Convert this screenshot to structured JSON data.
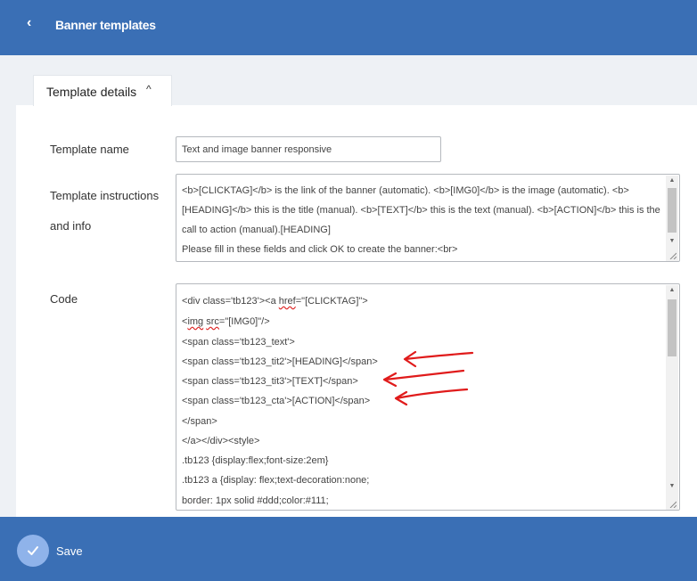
{
  "header": {
    "back_glyph": "‹",
    "title": "Banner templates"
  },
  "tab": {
    "label": "Template details",
    "chevron": "^"
  },
  "form": {
    "name_label": "Template name",
    "name_value": "Text and image banner responsive",
    "instructions_label_1": "Template instructions",
    "instructions_label_2": "and info",
    "instructions_text": "<b>[CLICKTAG]</b> is the link of the banner (automatic). <b>[IMG0]</b> is the image (automatic). <b>[HEADING]</b> this is the title (manual). <b>[TEXT]</b> this is the text (manual). <b>[ACTION]</b> this is the call to action (manual).[HEADING]",
    "instructions_text_2": "Please fill in these fields and click OK to create the banner:<br>",
    "code_label": "Code",
    "code_lines": {
      "l1_a": "<div class='tb123'><a ",
      "l1_b": "href",
      "l1_c": "=\"[CLICKTAG]\">",
      "l2_a": "<",
      "l2_b": "img",
      "l2_c": " ",
      "l2_d": "src",
      "l2_e": "=\"[IMG0]\"/>",
      "l3": "<span class='tb123_text'>",
      "l4": "<span class='tb123_tit2'>[HEADING]</span>",
      "l5": "<span class='tb123_tit3'>[TEXT]</span>",
      "l6": "<span class='tb123_cta'>[ACTION]</span>",
      "l7": "</span>",
      "l8": "</a></div><style>",
      "l9": ".tb123 {display:flex;font-size:2em}",
      "l10": ".tb123 a {display: flex;text-decoration:none;",
      "l11": "  border: 1px solid #ddd;color:#111;"
    }
  },
  "footer": {
    "save_label": "Save"
  },
  "colors": {
    "primary": "#3a6fb5",
    "save_circle": "#8fb3ea",
    "annotation_red": "#e01b1b"
  },
  "icons": [
    "back-chevron-icon",
    "chevron-up-icon",
    "check-icon",
    "scroll-up-arrow-icon",
    "scroll-down-arrow-icon",
    "resize-grip-icon",
    "red-arrow-annotation-icon"
  ]
}
